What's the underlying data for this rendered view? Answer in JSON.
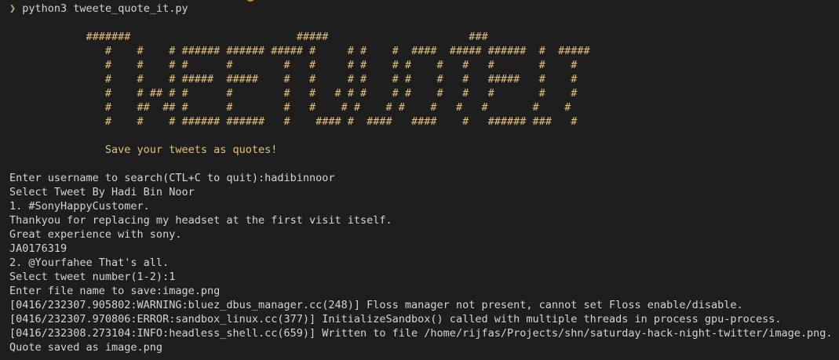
{
  "terminal": {
    "prompt_symbol": "❯",
    "command": "python3 tweete_quote_it.py",
    "colors": {
      "background": "#1e1e1e",
      "text": "#d4d4d4",
      "banner": "#e5c07b",
      "prompt": "#98c379"
    }
  },
  "banner": {
    "lines": [
      "            #######                          #####                      ###",
      "               #    #    # ###### ###### ##### #     # #    #  ####  ##### ######  #  #####",
      "               #    #    # #      #        #   #     # #    # #    #   #   #       #    #",
      "               #    #    # #####  #####    #   #     # #    # #    #   #   #####   #    #",
      "               #    # ## # #      #        #   #   # # #    # #    #   #   #       #    #",
      "               #    ##  ## #      #        #   #    # #    # #    #   #   #       #    #",
      "               #    #    # ###### ######   #    #### #  ####   ####    #   ###### ###   #"
    ],
    "tagline": "               Save your tweets as quotes!"
  },
  "output": {
    "lines": [
      "Enter username to search(CTL+C to quit):hadibinnoor",
      "Select Tweet By Hadi Bin Noor",
      "1. #SonyHappyCustomer.",
      "Thankyou for replacing my headset at the first visit itself.",
      "Great experience with sony.",
      "JA0176319",
      "2. @Yourfahee That's all.",
      "Select tweet number(1-2):1",
      "Enter file name to save:image.png",
      "[0416/232307.905802:WARNING:bluez_dbus_manager.cc(248)] Floss manager not present, cannot set Floss enable/disable.",
      "[0416/232307.970806:ERROR:sandbox_linux.cc(377)] InitializeSandbox() called with multiple threads in process gpu-process.",
      "[0416/232308.273104:INFO:headless_shell.cc(659)] Written to file /home/rijfas/Projects/shn/saturday-hack-night-twitter/image.png.",
      "Quote saved as image.png"
    ]
  }
}
